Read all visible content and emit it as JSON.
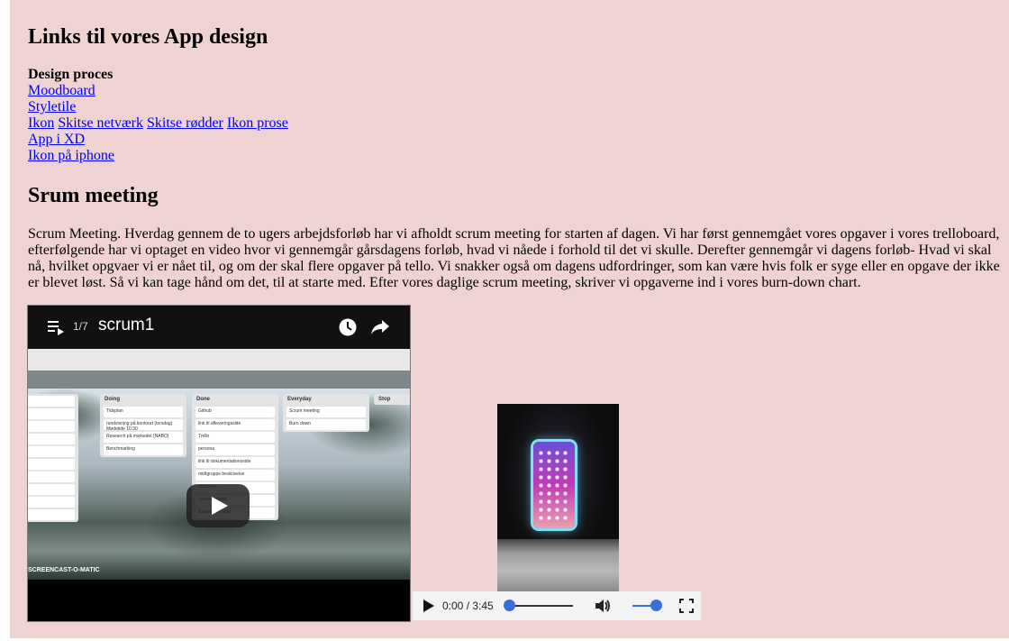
{
  "section1": {
    "heading": "Links til vores App design",
    "subheading": "Design proces",
    "links": {
      "moodboard": "Moodboard",
      "styletile": "Styletile ",
      "ikon": "Ikon",
      "skitse_netvaerk": "Skitse netværk",
      "skitse_rodder": "Skitse rødder",
      "ikon_prose": "Ikon prose",
      "app_i_xd": "App i XD",
      "ikon_paa_iphone": "Ikon på iphone"
    }
  },
  "section2": {
    "heading": "Srum meeting",
    "paragraph": "Scrum Meeting. Hverdag gennem de to ugers arbejdsforløb har vi afholdt scrum meeting for starten af dagen. Vi har først gennemgået vores opgaver i vores trelloboard, efterfølgende har vi optaget en video hvor vi gennemgår gårsdagens forløb, hvad vi nåede i forhold til det vi skulle. Derefter gennemgår vi dagens forløb- Hvad vi skal nå, hvilket opgvaer vi er nået til, og om der skal flere opgaver på tello. Vi snakker også om dagens udfordringer, som kan være hvis folk er syge eller en opgave der ikke er blevet løst. Så vi kan tage hånd om det, til at starte med. Efter vores daglige scrum meeting, skriver vi opgaverne ind i vores burn-down chart."
  },
  "youtube": {
    "playlist_counter": "1/7",
    "title": "scrum1",
    "board_columns": [
      {
        "name": "Doing",
        "cards": [
          "Tidsplan",
          "rundvisning på kontoret (torsdag) Mødetide 10:30",
          "Research på markedet (NABO)",
          "Benchmarking"
        ]
      },
      {
        "name": "Done",
        "cards": [
          "Github",
          "link til afleveringsside",
          "Trello",
          "persona",
          "link til dokumentationsside",
          "midtgruppe beskrivelse",
          "personas",
          "canvas model",
          "Experience Map"
        ]
      },
      {
        "name": "Everyday",
        "cards": [
          "Scrum meeting",
          "Burn down"
        ]
      },
      {
        "name": "Stop",
        "cards": []
      }
    ],
    "watermark": "SCREENCAST-O-MATIC",
    "icons": [
      "playlist-icon",
      "clock-icon",
      "share-icon",
      "play-icon"
    ]
  },
  "video_player": {
    "time": "0:00 / 3:45",
    "progress": 0,
    "volume": 1.0,
    "icons": [
      "play-icon",
      "volume-icon",
      "fullscreen-icon"
    ]
  }
}
